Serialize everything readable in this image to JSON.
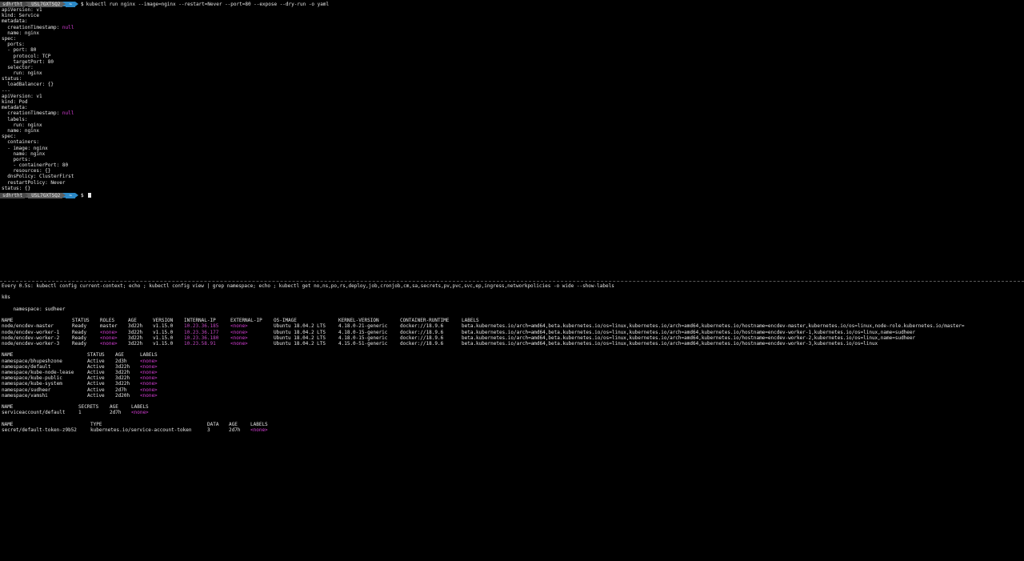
{
  "prompt": {
    "user": "sdhrtht",
    "host": "USL7GXTSQ2",
    "dir": "~",
    "symbol": "$"
  },
  "top": {
    "command": "kubectl run nginx --image=nginx --restart=Never --port=80 --expose --dry-run -o yaml",
    "yaml_lines": [
      "apiVersion: v1",
      "kind: Service",
      "metadata:",
      "  creationTimestamp: ",
      "  name: nginx",
      "spec:",
      "  ports:",
      "  - port: 80",
      "    protocol: TCP",
      "    targetPort: 80",
      "  selector:",
      "    run: nginx",
      "status:",
      "  loadBalancer: {}",
      "---",
      "apiVersion: v1",
      "kind: Pod",
      "metadata:",
      "  creationTimestamp: ",
      "  labels:",
      "    run: nginx",
      "  name: nginx",
      "spec:",
      "  containers:",
      "  - image: nginx",
      "    name: nginx",
      "    ports:",
      "    - containerPort: 80",
      "    resources: {}",
      "  dnsPolicy: ClusterFirst",
      "  restartPolicy: Never",
      "status: {}"
    ],
    "null_word": "null"
  },
  "bottom": {
    "watch_header": "Every 0.5s: kubectl config current-context; echo ; kubectl config view | grep namespace; echo ; kubectl get no,ns,po,rs,deploy,job,cronjob,cm,sa,secrets,pv,pvc,svc,ep,ingress,networkpolicies -o wide --show-labels",
    "context": "k8s",
    "namespace_line": "    namespace: sudheer",
    "nodes": {
      "headers": [
        "NAME",
        "STATUS",
        "ROLES",
        "AGE",
        "VERSION",
        "INTERNAL-IP",
        "EXTERNAL-IP",
        "OS-IMAGE",
        "KERNEL-VERSION",
        "CONTAINER-RUNTIME",
        "LABELS"
      ],
      "rows": [
        [
          "node/encdev-master",
          "Ready",
          "master",
          "3d22h",
          "v1.15.0",
          "10.23.36.185",
          "<none>",
          "Ubuntu 18.04.2 LTS",
          "4.18.0-21-generic",
          "docker://18.9.6",
          "beta.kubernetes.io/arch=amd64,beta.kubernetes.io/os=linux,kubernetes.io/arch=amd64,kubernetes.io/hostname=encdev-master,kubernetes.io/os=linux,node-role.kubernetes.io/master="
        ],
        [
          "node/encdev-worker-1",
          "Ready",
          "<none>",
          "3d22h",
          "v1.15.0",
          "10.23.36.177",
          "<none>",
          "Ubuntu 18.04.2 LTS",
          "4.18.0-15-generic",
          "docker://18.9.6",
          "beta.kubernetes.io/arch=amd64,beta.kubernetes.io/os=linux,kubernetes.io/arch=amd64,kubernetes.io/hostname=encdev-worker-1,kubernetes.io/os=linux,name=sudheer"
        ],
        [
          "node/encdev-worker-2",
          "Ready",
          "<none>",
          "3d22h",
          "v1.15.0",
          "10.23.36.180",
          "<none>",
          "Ubuntu 18.04.2 LTS",
          "4.18.0-15-generic",
          "docker://18.9.6",
          "beta.kubernetes.io/arch=amd64,beta.kubernetes.io/os=linux,kubernetes.io/arch=amd64,kubernetes.io/hostname=encdev-worker-2,kubernetes.io/os=linux,name=sudheer"
        ],
        [
          "node/encdev-worker-3",
          "Ready",
          "<none>",
          "3d22h",
          "v1.15.0",
          "10.23.58.91",
          "<none>",
          "Ubuntu 18.04.2 LTS",
          "4.15.0-51-generic",
          "docker://18.9.6",
          "beta.kubernetes.io/arch=amd64,beta.kubernetes.io/os=linux,kubernetes.io/arch=amd64,kubernetes.io/hostname=encdev-worker-3,kubernetes.io/os=linux"
        ]
      ]
    },
    "namespaces": {
      "headers": [
        "NAME",
        "STATUS",
        "AGE",
        "LABELS"
      ],
      "rows": [
        [
          "namespace/bhupeshzone",
          "Active",
          "2d3h",
          "<none>"
        ],
        [
          "namespace/default",
          "Active",
          "3d22h",
          "<none>"
        ],
        [
          "namespace/kube-node-lease",
          "Active",
          "3d22h",
          "<none>"
        ],
        [
          "namespace/kube-public",
          "Active",
          "3d22h",
          "<none>"
        ],
        [
          "namespace/kube-system",
          "Active",
          "3d22h",
          "<none>"
        ],
        [
          "namespace/sudheer",
          "Active",
          "2d7h",
          "<none>"
        ],
        [
          "namespace/vamshi",
          "Active",
          "2d20h",
          "<none>"
        ]
      ]
    },
    "serviceaccounts": {
      "headers": [
        "NAME",
        "SECRETS",
        "AGE",
        "LABELS"
      ],
      "rows": [
        [
          "serviceaccount/default",
          "1",
          "2d7h",
          "<none>"
        ]
      ]
    },
    "secrets": {
      "headers": [
        "NAME",
        "TYPE",
        "DATA",
        "AGE",
        "LABELS"
      ],
      "rows": [
        [
          "secret/default-token-z9b52",
          "kubernetes.io/service-account-token",
          "3",
          "2d7h",
          "<none>"
        ]
      ]
    }
  },
  "colors": {
    "background": "#000000",
    "foreground": "#e6e6e6",
    "accent_magenta": "#d93fd9",
    "prompt_dir": "#2b88c6"
  }
}
